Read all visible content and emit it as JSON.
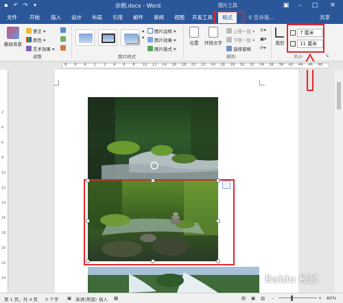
{
  "window": {
    "title": "示例.docx - Word",
    "context_tab_group": "图片工具"
  },
  "tabs": [
    {
      "label": "文件"
    },
    {
      "label": "开始"
    },
    {
      "label": "插入"
    },
    {
      "label": "设计"
    },
    {
      "label": "布局"
    },
    {
      "label": "引用"
    },
    {
      "label": "邮件"
    },
    {
      "label": "审阅"
    },
    {
      "label": "视图"
    },
    {
      "label": "开发工具"
    },
    {
      "label": "格式"
    }
  ],
  "tell_me": "♀ 告诉我...",
  "share": "共享",
  "ribbon": {
    "adjust": {
      "remove_bg": "删除背景",
      "corrections": "更正",
      "color": "颜色",
      "artistic": "艺术效果",
      "label": "调整"
    },
    "picture_styles": {
      "border": "图片边框",
      "effects": "图片效果",
      "layout": "图片版式",
      "label": "图片样式"
    },
    "arrange": {
      "position": "位置",
      "wrap": "环绕文字",
      "bring_forward": "上移一层",
      "send_backward": "下移一层",
      "selection_pane": "选择窗格",
      "label": "排列"
    },
    "size": {
      "crop": "裁剪",
      "height": "7 厘米",
      "width": "11 厘米",
      "label": "大小"
    }
  },
  "ruler_numbers": [
    "8",
    "6",
    "4",
    "2",
    "2",
    "4",
    "6",
    "8",
    "10",
    "12",
    "14",
    "16",
    "18",
    "20",
    "22",
    "24",
    "26",
    "28",
    "30",
    "32",
    "34",
    "36",
    "38",
    "42",
    "44",
    "46",
    "48"
  ],
  "vruler_numbers": [
    "2",
    "4",
    "6",
    "8",
    "10",
    "12",
    "14",
    "16",
    "18",
    "20",
    "22",
    "24"
  ],
  "status": {
    "page": "第 1 页，共 4 页",
    "words": "0 个字",
    "language": "英语(美国)",
    "mode": "插入",
    "zoom": "80%"
  },
  "colors": {
    "word_blue": "#2b579a",
    "highlight_red": "#e1252b"
  },
  "watermark": "Baidu 经验"
}
